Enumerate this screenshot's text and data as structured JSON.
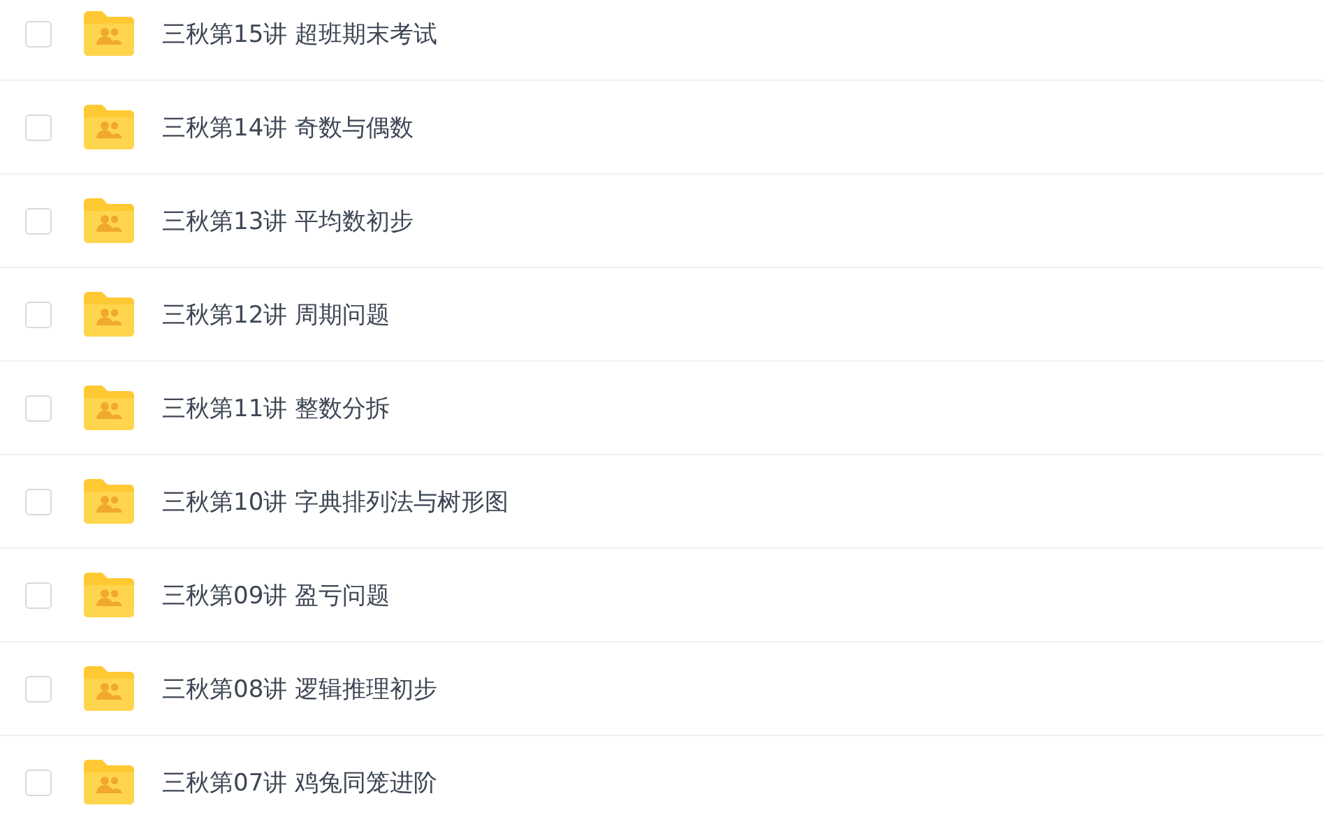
{
  "files": [
    {
      "name": "三秋第15讲 超班期末考试",
      "checked": false
    },
    {
      "name": "三秋第14讲 奇数与偶数",
      "checked": false
    },
    {
      "name": "三秋第13讲 平均数初步",
      "checked": false
    },
    {
      "name": "三秋第12讲 周期问题",
      "checked": false
    },
    {
      "name": "三秋第11讲 整数分拆",
      "checked": false
    },
    {
      "name": "三秋第10讲 字典排列法与树形图",
      "checked": false
    },
    {
      "name": "三秋第09讲 盈亏问题",
      "checked": false
    },
    {
      "name": "三秋第08讲 逻辑推理初步",
      "checked": false
    },
    {
      "name": "三秋第07讲 鸡兔同笼进阶",
      "checked": false
    }
  ]
}
